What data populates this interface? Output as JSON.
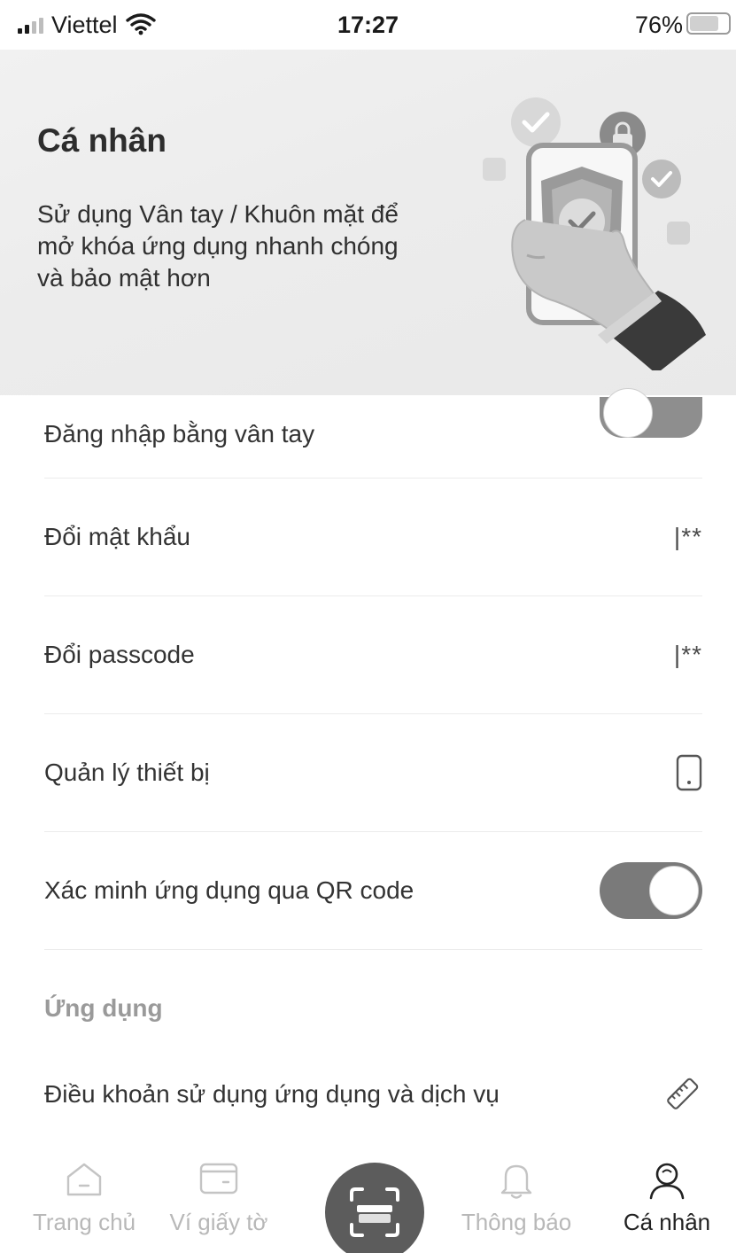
{
  "status_bar": {
    "carrier": "Viettel",
    "time": "17:27",
    "battery_percent": "76%",
    "battery_level": 0.76,
    "signal_bars_active": 2,
    "signal_bars_total": 4
  },
  "hero": {
    "title": "Cá nhân",
    "description": "Sử dụng Vân tay / Khuôn mặt để mở  khóa ứng dụng nhanh chóng và bảo mật hơn",
    "illustration_icon": "hand-phone-shield-illustration"
  },
  "settings": {
    "fingerprint_login": {
      "label": "Đăng nhập bằng vân tay",
      "enabled": false
    },
    "change_password": {
      "label": "Đổi mật khẩu",
      "value": "|**"
    },
    "change_passcode": {
      "label": "Đổi passcode",
      "value": "|**"
    },
    "device_management": {
      "label": "Quản lý thiết bị",
      "icon": "phone-icon"
    },
    "qr_verification": {
      "label": "Xác minh ứng dụng qua QR code",
      "enabled": true
    }
  },
  "app_section": {
    "title": "Ứng dụng",
    "terms": {
      "label": "Điều khoản sử dụng ứng dụng và dịch vụ",
      "icon": "ruler-icon"
    }
  },
  "tabbar": {
    "home": {
      "label": "Trang chủ",
      "icon": "home-icon"
    },
    "wallet": {
      "label": "Ví giấy tờ",
      "icon": "wallet-icon"
    },
    "scan": {
      "icon": "scan-icon"
    },
    "notifications": {
      "label": "Thông báo",
      "icon": "bell-icon"
    },
    "profile": {
      "label": "Cá nhân",
      "icon": "user-icon"
    }
  },
  "colors": {
    "text_primary": "#333333",
    "text_muted": "#9a9a9a",
    "toggle_track": "#7a7a7a",
    "scan_button": "#5c5c5c"
  }
}
